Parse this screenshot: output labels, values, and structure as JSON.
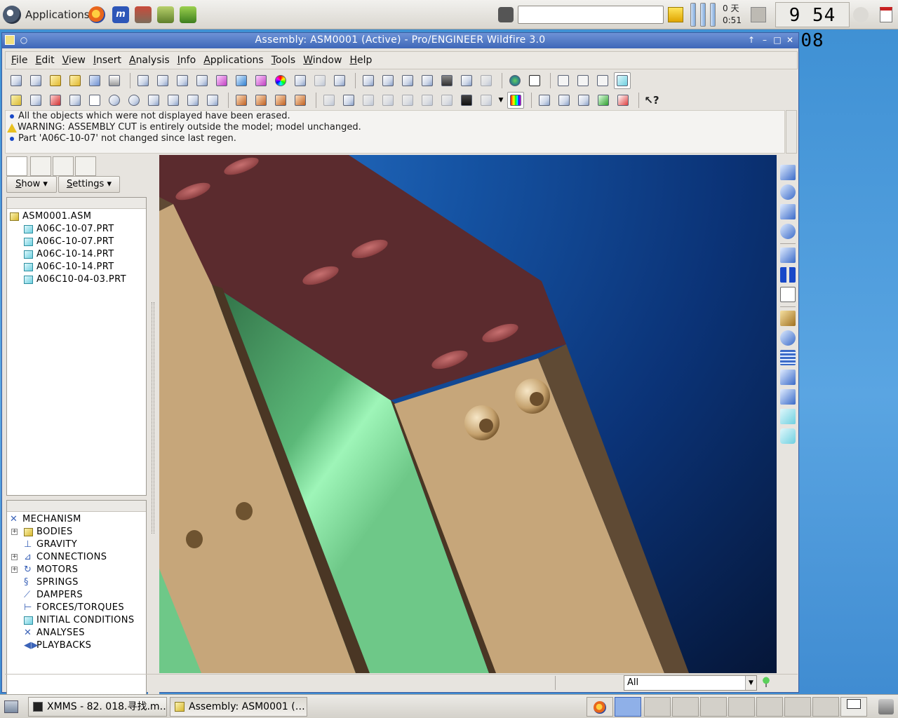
{
  "top_panel": {
    "applications_label": "Applications",
    "uptime_days": "0 天",
    "uptime_time": "0:51",
    "clock": "9 54 08",
    "search_placeholder": ""
  },
  "window": {
    "title": "Assembly: ASM0001 (Active) - Pro/ENGINEER Wildfire 3.0"
  },
  "menu": [
    "File",
    "Edit",
    "View",
    "Insert",
    "Analysis",
    "Info",
    "Applications",
    "Tools",
    "Window",
    "Help"
  ],
  "messages": [
    {
      "type": "info",
      "text": "All the objects which were not displayed have been erased."
    },
    {
      "type": "warning",
      "text": "WARNING: ASSEMBLY CUT is entirely outside the model; model unchanged."
    },
    {
      "type": "info",
      "text": "Part 'A06C-10-07' not changed since last regen."
    }
  ],
  "left_panel": {
    "show_label": "Show",
    "settings_label": "Settings",
    "model_tree": {
      "root": "ASM0001.ASM",
      "parts": [
        "A06C-10-07.PRT",
        "A06C-10-07.PRT",
        "A06C-10-14.PRT",
        "A06C-10-14.PRT",
        "A06C10-04-03.PRT"
      ]
    },
    "mechanism_tree": {
      "root": "MECHANISM",
      "items": [
        "BODIES",
        "GRAVITY",
        "CONNECTIONS",
        "MOTORS",
        "SPRINGS",
        "DAMPERS",
        "FORCES/TORQUES",
        "INITIAL CONDITIONS",
        "ANALYSES",
        "PLAYBACKS"
      ]
    }
  },
  "statusbar": {
    "filter_value": "All"
  },
  "taskbar": {
    "tasks": [
      "XMMS - 82. 018.寻找.m…",
      "Assembly: ASM0001 (…"
    ]
  },
  "colors": {
    "title_blue": "#3e67b8",
    "plate_maroon": "#5b2b2e",
    "wood_tan": "#c6a67a",
    "green_face": "#6ec888",
    "background_navy": "#0b3377"
  }
}
